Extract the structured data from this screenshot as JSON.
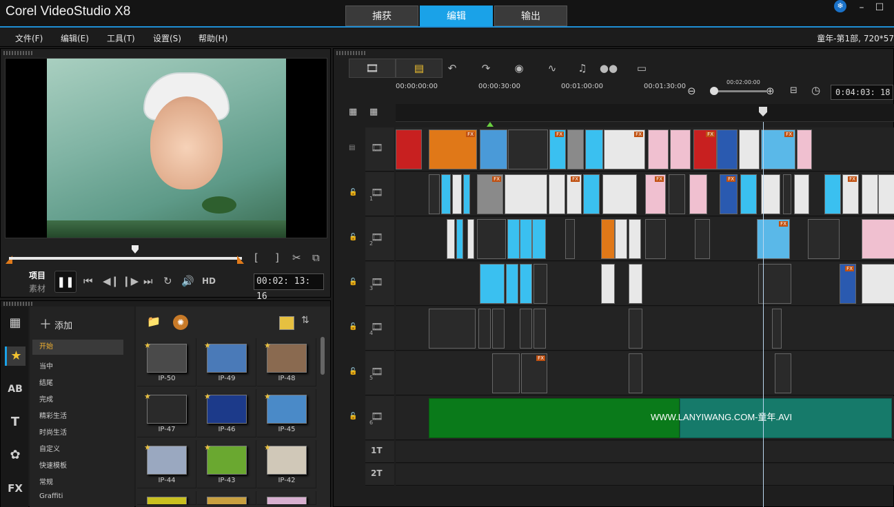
{
  "app": {
    "title": "Corel VideoStudio X8",
    "mode_tabs": [
      "捕获",
      "编辑",
      "输出"
    ],
    "active_tab": "编辑",
    "accent_color": "#1aa2e8"
  },
  "menu": {
    "items": [
      "文件(F)",
      "编辑(E)",
      "工具(T)",
      "设置(S)",
      "帮助(H)"
    ],
    "project_info": "童年-第1部, 720*57"
  },
  "player": {
    "mode_project": "项目",
    "mode_clip": "素材",
    "hd_label": "HD",
    "timecode": "00:02: 13: 16",
    "brackets": [
      "[",
      "]"
    ]
  },
  "library": {
    "add_label": "添加",
    "categories": [
      "开始",
      "当中",
      "结尾",
      "完成",
      "精彩生活",
      "时尚生活",
      "自定义",
      "快速模板",
      "常规",
      "Graffiti"
    ],
    "active_category": "开始",
    "side_icons": [
      "media-icon",
      "instant-project-icon",
      "transition-icon",
      "title-icon",
      "graphics-icon",
      "filter-icon"
    ],
    "side_labels": [
      "▦",
      "★",
      "AB",
      "T",
      "✿",
      "FX"
    ],
    "thumbnails": [
      {
        "label": "IP-50",
        "color": "#4a4a4a"
      },
      {
        "label": "IP-49",
        "color": "#4a7ab8"
      },
      {
        "label": "IP-48",
        "color": "#8a6a50"
      },
      {
        "label": "IP-47",
        "color": "#2a2a2a"
      },
      {
        "label": "IP-46",
        "color": "#1c3a8a"
      },
      {
        "label": "IP-45",
        "color": "#4a8ac8"
      },
      {
        "label": "IP-44",
        "color": "#9aa8c0"
      },
      {
        "label": "IP-43",
        "color": "#6aa830"
      },
      {
        "label": "IP-42",
        "color": "#d0c8b8"
      }
    ]
  },
  "timeline": {
    "ruler_timecodes": [
      "00:00:00:00",
      "00:00:30:00",
      "00:01:00:00",
      "00:01:30:00",
      "00:02:00:00"
    ],
    "timecode": "0:04:03: 18",
    "tracks": [
      {
        "name": "video-track",
        "label": ""
      },
      {
        "name": "overlay-track-1",
        "label": "1"
      },
      {
        "name": "overlay-track-2",
        "label": "2"
      },
      {
        "name": "overlay-track-3",
        "label": "3"
      },
      {
        "name": "overlay-track-4",
        "label": "4"
      },
      {
        "name": "overlay-track-5",
        "label": "5"
      },
      {
        "name": "overlay-track-6",
        "label": "6"
      }
    ],
    "title_tracks": [
      "1T",
      "2T"
    ],
    "audio_clip_label": "WWW.LANYIWANG.COM-童年.AVI",
    "fx_label": "FX"
  }
}
